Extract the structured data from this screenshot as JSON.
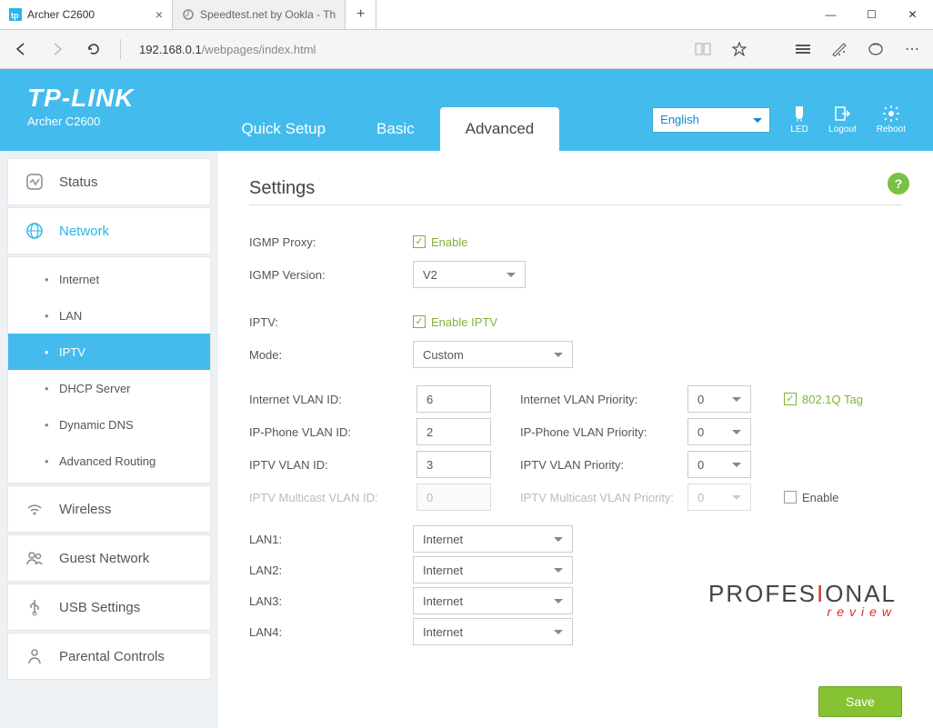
{
  "browser": {
    "tabs": [
      {
        "title": "Archer C2600",
        "active": true
      },
      {
        "title": "Speedtest.net by Ookla - Th",
        "active": false
      }
    ],
    "url_host": "192.168.0.1",
    "url_path": "/webpages/index.html"
  },
  "header": {
    "brand": "TP-LINK",
    "model": "Archer C2600",
    "tabs": {
      "quick": "Quick Setup",
      "basic": "Basic",
      "advanced": "Advanced"
    },
    "language": "English",
    "icons": {
      "led": "LED",
      "logout": "Logout",
      "reboot": "Reboot"
    }
  },
  "sidebar": {
    "status": "Status",
    "network": "Network",
    "network_items": {
      "internet": "Internet",
      "lan": "LAN",
      "iptv": "IPTV",
      "dhcp": "DHCP Server",
      "ddns": "Dynamic DNS",
      "routing": "Advanced Routing"
    },
    "wireless": "Wireless",
    "guest": "Guest Network",
    "usb": "USB Settings",
    "parental": "Parental Controls"
  },
  "page": {
    "title": "Settings",
    "igmp_proxy_label": "IGMP Proxy:",
    "igmp_proxy_enable": "Enable",
    "igmp_version_label": "IGMP Version:",
    "igmp_version_value": "V2",
    "iptv_label": "IPTV:",
    "iptv_enable": "Enable IPTV",
    "mode_label": "Mode:",
    "mode_value": "Custom",
    "vlan": {
      "internet_id_label": "Internet VLAN ID:",
      "internet_id": "6",
      "internet_pri_label": "Internet VLAN Priority:",
      "internet_pri": "0",
      "tag_label": "802.1Q Tag",
      "ipphone_id_label": "IP-Phone VLAN ID:",
      "ipphone_id": "2",
      "ipphone_pri_label": "IP-Phone VLAN Priority:",
      "ipphone_pri": "0",
      "iptv_id_label": "IPTV VLAN ID:",
      "iptv_id": "3",
      "iptv_pri_label": "IPTV VLAN Priority:",
      "iptv_pri": "0",
      "mcast_id_label": "IPTV Multicast VLAN ID:",
      "mcast_id": "0",
      "mcast_pri_label": "IPTV Multicast VLAN Priority:",
      "mcast_pri": "0",
      "mcast_enable": "Enable"
    },
    "lan": {
      "lan1_label": "LAN1:",
      "lan1_value": "Internet",
      "lan2_label": "LAN2:",
      "lan2_value": "Internet",
      "lan3_label": "LAN3:",
      "lan3_value": "Internet",
      "lan4_label": "LAN4:",
      "lan4_value": "Internet"
    },
    "save": "Save"
  },
  "watermark": {
    "main": "PROFES",
    "main2": "ONAL",
    "sub": "review"
  }
}
